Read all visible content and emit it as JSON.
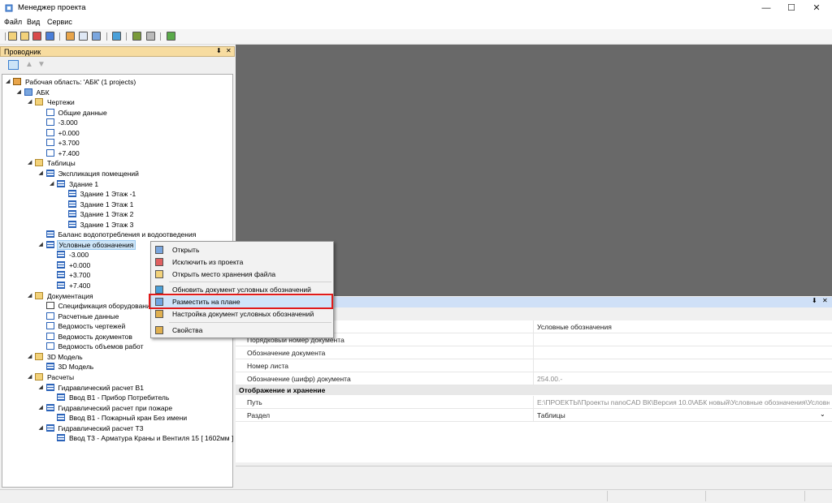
{
  "window": {
    "title": "Менеджер проекта",
    "minimize": "—",
    "maximize": "☐",
    "close": "✕"
  },
  "menu": [
    "Файл",
    "Вид",
    "Сервис"
  ],
  "explorer": {
    "title": "Проводник",
    "pin": "⬇",
    "close": "✕"
  },
  "tree": [
    {
      "label": "Рабочая область: 'АБК' (1 projects)",
      "icon": "workspace-icon",
      "level": 0,
      "expanded": true
    },
    {
      "label": "АБК",
      "icon": "project-icon",
      "level": 1,
      "expanded": true
    },
    {
      "label": "Чертежи",
      "icon": "folder-icon",
      "level": 2,
      "expanded": true
    },
    {
      "label": "Общие данные",
      "icon": "sheet-icon",
      "level": 3
    },
    {
      "label": "-3.000",
      "icon": "sheet-icon",
      "level": 3
    },
    {
      "label": "+0.000",
      "icon": "sheet-icon",
      "level": 3
    },
    {
      "label": "+3.700",
      "icon": "sheet-icon",
      "level": 3
    },
    {
      "label": "+7.400",
      "icon": "sheet-icon",
      "level": 3
    },
    {
      "label": "Таблицы",
      "icon": "folder-icon",
      "level": 2,
      "expanded": true
    },
    {
      "label": "Экспликация помещений",
      "icon": "table-icon",
      "level": 3,
      "expanded": true
    },
    {
      "label": "Здание 1",
      "icon": "table-icon",
      "level": 4,
      "expanded": true
    },
    {
      "label": "Здание 1 Этаж -1",
      "icon": "table-icon",
      "level": 5
    },
    {
      "label": "Здание 1 Этаж 1",
      "icon": "table-icon",
      "level": 5
    },
    {
      "label": "Здание 1 Этаж 2",
      "icon": "table-icon",
      "level": 5
    },
    {
      "label": "Здание 1 Этаж 3",
      "icon": "table-icon",
      "level": 5
    },
    {
      "label": "Баланс водопотребления и водоотведения",
      "icon": "table-icon",
      "level": 3
    },
    {
      "label": "Условные обозначения",
      "icon": "table-icon",
      "level": 3,
      "expanded": true,
      "selected": true
    },
    {
      "label": "-3.000",
      "icon": "table-icon",
      "level": 4
    },
    {
      "label": "+0.000",
      "icon": "table-icon",
      "level": 4
    },
    {
      "label": "+3.700",
      "icon": "table-icon",
      "level": 4
    },
    {
      "label": "+7.400",
      "icon": "table-icon",
      "level": 4
    },
    {
      "label": "Документация",
      "icon": "folder-icon",
      "level": 2,
      "expanded": true
    },
    {
      "label": "Спецификация оборудования",
      "icon": "spec-icon",
      "level": 3
    },
    {
      "label": "Расчетные данные",
      "icon": "sheet-icon",
      "level": 3
    },
    {
      "label": "Ведомость чертежей",
      "icon": "sheet-icon",
      "level": 3
    },
    {
      "label": "Ведомость документов",
      "icon": "sheet-icon",
      "level": 3
    },
    {
      "label": "Ведомость объемов работ",
      "icon": "sheet-icon",
      "level": 3
    },
    {
      "label": "3D Модель",
      "icon": "folder-icon",
      "level": 2,
      "expanded": true
    },
    {
      "label": "3D Модель",
      "icon": "table-icon",
      "level": 3
    },
    {
      "label": "Расчеты",
      "icon": "folder-icon",
      "level": 2,
      "expanded": true
    },
    {
      "label": "Гидравлический расчет В1",
      "icon": "table-icon",
      "level": 3,
      "expanded": true
    },
    {
      "label": "Ввод В1 - Прибор Потребитель",
      "icon": "table-icon",
      "level": 4
    },
    {
      "label": "Гидравлический расчет при пожаре",
      "icon": "table-icon",
      "level": 3,
      "expanded": true
    },
    {
      "label": "Ввод В1 - Пожарный кран Без имени",
      "icon": "table-icon",
      "level": 4
    },
    {
      "label": "Гидравлический расчет Т3",
      "icon": "table-icon",
      "level": 3,
      "expanded": true
    },
    {
      "label": "Ввод Т3 - Арматура Краны и Вентиля 15 [ 1602мм ]",
      "icon": "table-icon",
      "level": 4
    }
  ],
  "context_menu": [
    {
      "label": "Открыть",
      "icon": "open-icon"
    },
    {
      "label": "Исключить из проекта",
      "icon": "exclude-icon"
    },
    {
      "label": "Открыть место хранения файла",
      "icon": "folder-open-icon"
    },
    {
      "label": "Обновить документ условных обозначений",
      "icon": "refresh-icon"
    },
    {
      "label": "Разместить на плане",
      "icon": "place-icon",
      "highlighted": true
    },
    {
      "label": "Настройка документ условных обозначений",
      "icon": "settings-icon"
    },
    {
      "label": "Свойства",
      "icon": "properties-icon"
    }
  ],
  "properties": {
    "pin": "⬇",
    "close": "✕",
    "rows": [
      {
        "key": "",
        "value": "Условные обозначения"
      },
      {
        "key": "Порядковый номер документа",
        "value": ""
      },
      {
        "key": "Обозначение документа",
        "value": ""
      },
      {
        "key": "Номер листа",
        "value": ""
      },
      {
        "key": "Обозначение (шифр) документа",
        "value": "254.00.-",
        "grey": true
      }
    ],
    "category": "Отображение и хранение",
    "rows2": [
      {
        "key": "Путь",
        "value": "E:\\ПРОЕКТЫ\\Проекты nanoCAD ВК\\Версия 10.0\\АБК новый\\Условные обозначения\\Условные",
        "grey": true
      },
      {
        "key": "Раздел",
        "value": "Таблицы"
      }
    ]
  },
  "colors": {
    "accent_highlight": "#e01b1b",
    "workspace_bg": "#696969",
    "panel_header": "#f7dca0"
  }
}
